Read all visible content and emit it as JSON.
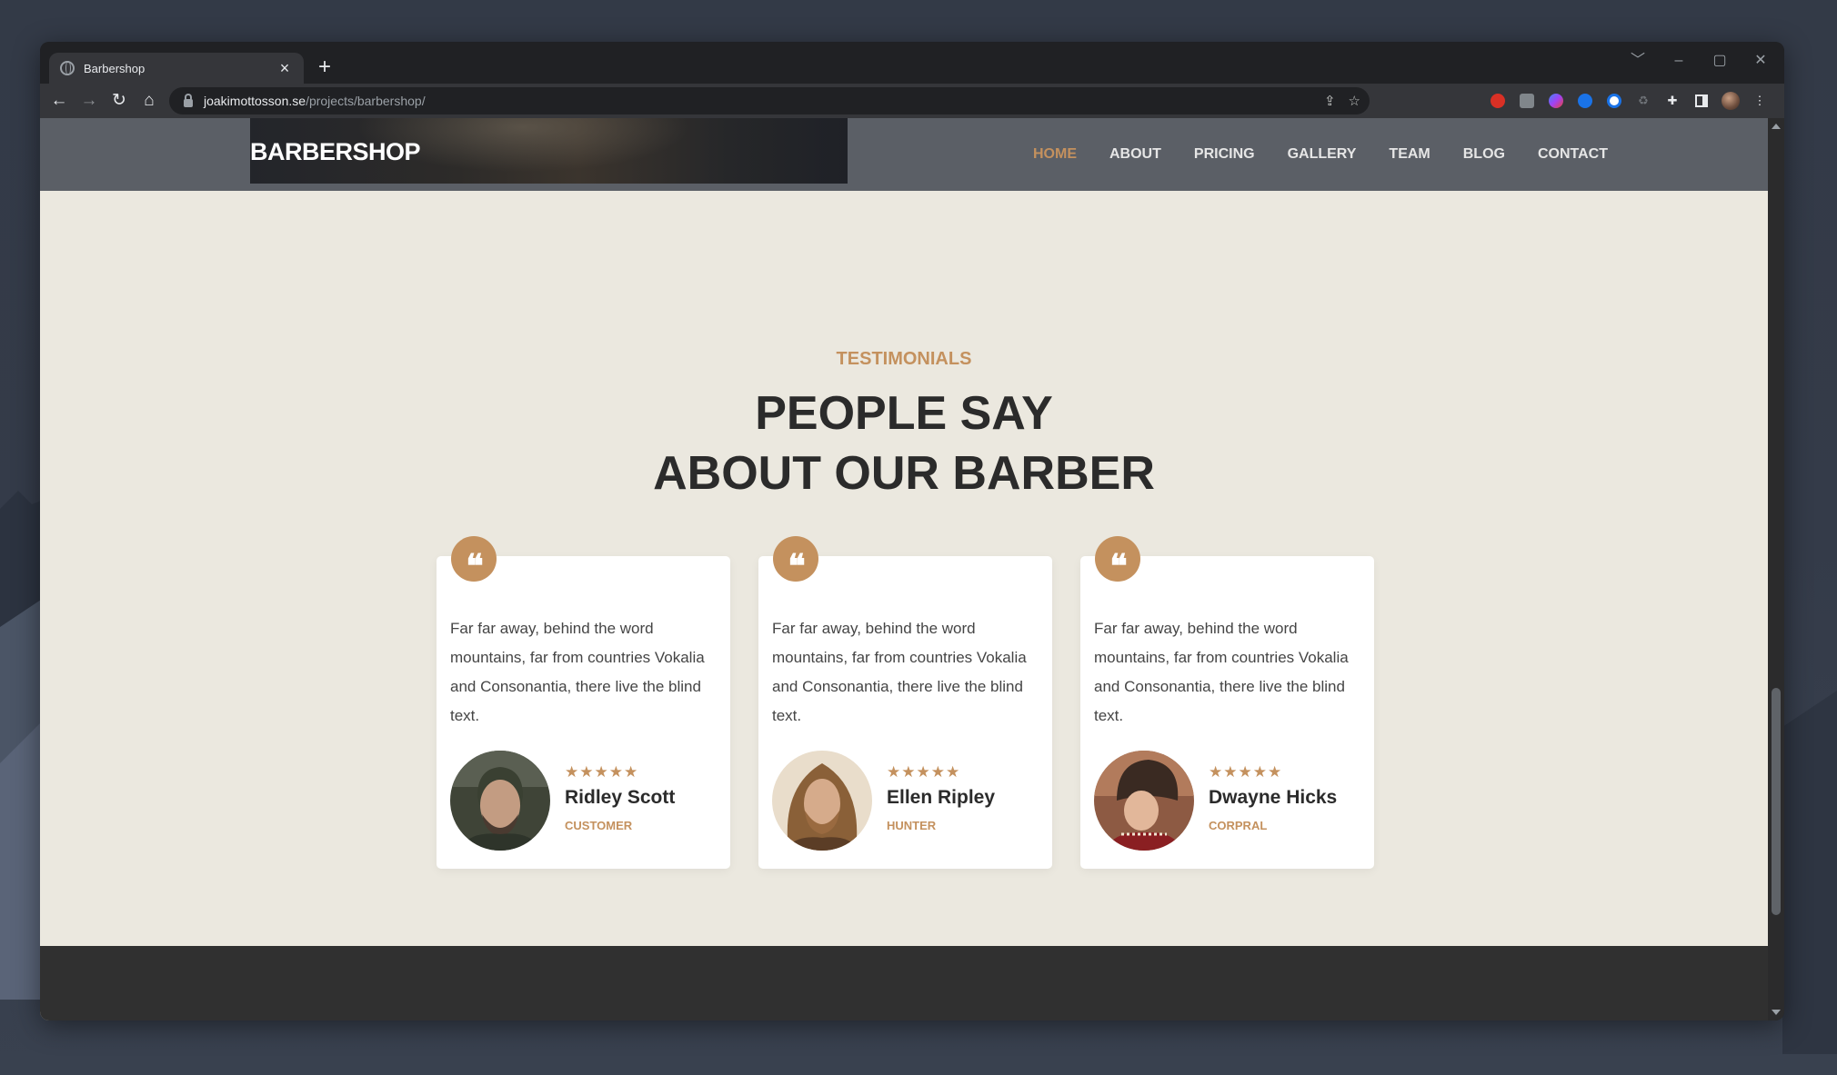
{
  "browser": {
    "tab_title": "Barbershop",
    "tab_close": "×",
    "new_tab": "+",
    "url_host": "joakimottosson.se",
    "url_path": "/projects/barbershop/",
    "window_controls": [
      "﹀",
      "–",
      "▢",
      "✕"
    ]
  },
  "site": {
    "brand": "BARBERSHOP",
    "menu": [
      {
        "label": "HOME",
        "active": true
      },
      {
        "label": "ABOUT",
        "active": false
      },
      {
        "label": "PRICING",
        "active": false
      },
      {
        "label": "GALLERY",
        "active": false
      },
      {
        "label": "TEAM",
        "active": false
      },
      {
        "label": "BLOG",
        "active": false
      },
      {
        "label": "CONTACT",
        "active": false
      }
    ]
  },
  "testimonials": {
    "eyebrow": "TESTIMONIALS",
    "heading_line1": "PEOPLE SAY",
    "heading_line2": "ABOUT OUR BARBER",
    "quote_glyph": "❝",
    "cards": [
      {
        "text": "Far far away, behind the word mountains, far from countries Vokalia and Consonantia, there live the blind text.",
        "stars": "★★★★★",
        "name": "Ridley Scott",
        "role": "CUSTOMER"
      },
      {
        "text": "Far far away, behind the word mountains, far from countries Vokalia and Consonantia, there live the blind text.",
        "stars": "★★★★★",
        "name": "Ellen Ripley",
        "role": "HUNTER"
      },
      {
        "text": "Far far away, behind the word mountains, far from countries Vokalia and Consonantia, there live the blind text.",
        "stars": "★★★★★",
        "name": "Dwayne Hicks",
        "role": "CORPRAL"
      }
    ]
  },
  "colors": {
    "accent": "#c4915e",
    "page_bg": "#ebe8df",
    "nav_bg": "#5b5f66",
    "footer_bg": "#303030",
    "heading": "#2b2b2b"
  },
  "icons": {
    "toolbar": [
      "back-icon",
      "forward-icon",
      "reload-icon",
      "home-icon"
    ],
    "omnibox": [
      "share-icon",
      "star-icon"
    ],
    "extensions": [
      "red-ext-icon",
      "gray-ext-icon",
      "blue-ext-icon",
      "gear-ext-icon",
      "password-ext-icon",
      "recycle-ext-icon",
      "puzzle-icon",
      "sidepanel-icon",
      "profile-avatar",
      "kebab-menu-icon"
    ]
  }
}
